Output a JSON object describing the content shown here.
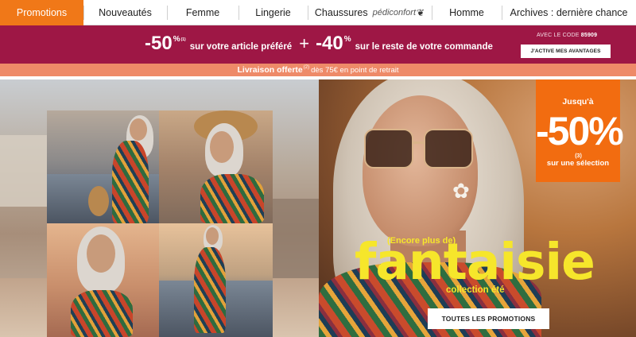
{
  "nav": {
    "items": [
      {
        "label": "Promotions",
        "active": true
      },
      {
        "label": "Nouveautés"
      },
      {
        "label": "Femme"
      },
      {
        "label": "Lingerie"
      },
      {
        "label": "Chaussures",
        "brand": "pédiconfort"
      },
      {
        "label": "Homme"
      },
      {
        "label": "Archives : dernière chance"
      }
    ]
  },
  "promo": {
    "discount1": "-50",
    "discount1_sup": "%",
    "discount1_sup_mark": "(1)",
    "text1": "sur votre article préféré",
    "plus": "+",
    "discount2": "-40",
    "discount2_sup": "%",
    "text2": "sur le reste de votre commande",
    "code_label": "AVEC LE CODE",
    "code_value": "85909",
    "cta": "J'ACTIVE MES AVANTAGES"
  },
  "delivery": {
    "strong": "Livraison offerte",
    "mark": "(2)",
    "text": "dès 75€ en point de retrait"
  },
  "hero": {
    "badge": {
      "upto": "Jusqu'à",
      "value": "-50%",
      "mark": "(3)",
      "selection": "sur une sélection"
    },
    "encore": "(Encore plus de)",
    "title": "fantaisie",
    "subtitle": "collection été",
    "button": "TOUTES LES PROMOTIONS"
  },
  "colors": {
    "nav_active": "#f07818",
    "promo_bg": "#9e1745",
    "delivery_bg": "#ee8a68",
    "badge_bg": "#f26c10",
    "headline_yellow": "#f6e62b"
  },
  "icons": {
    "brand_mark": "butterfly-icon"
  }
}
